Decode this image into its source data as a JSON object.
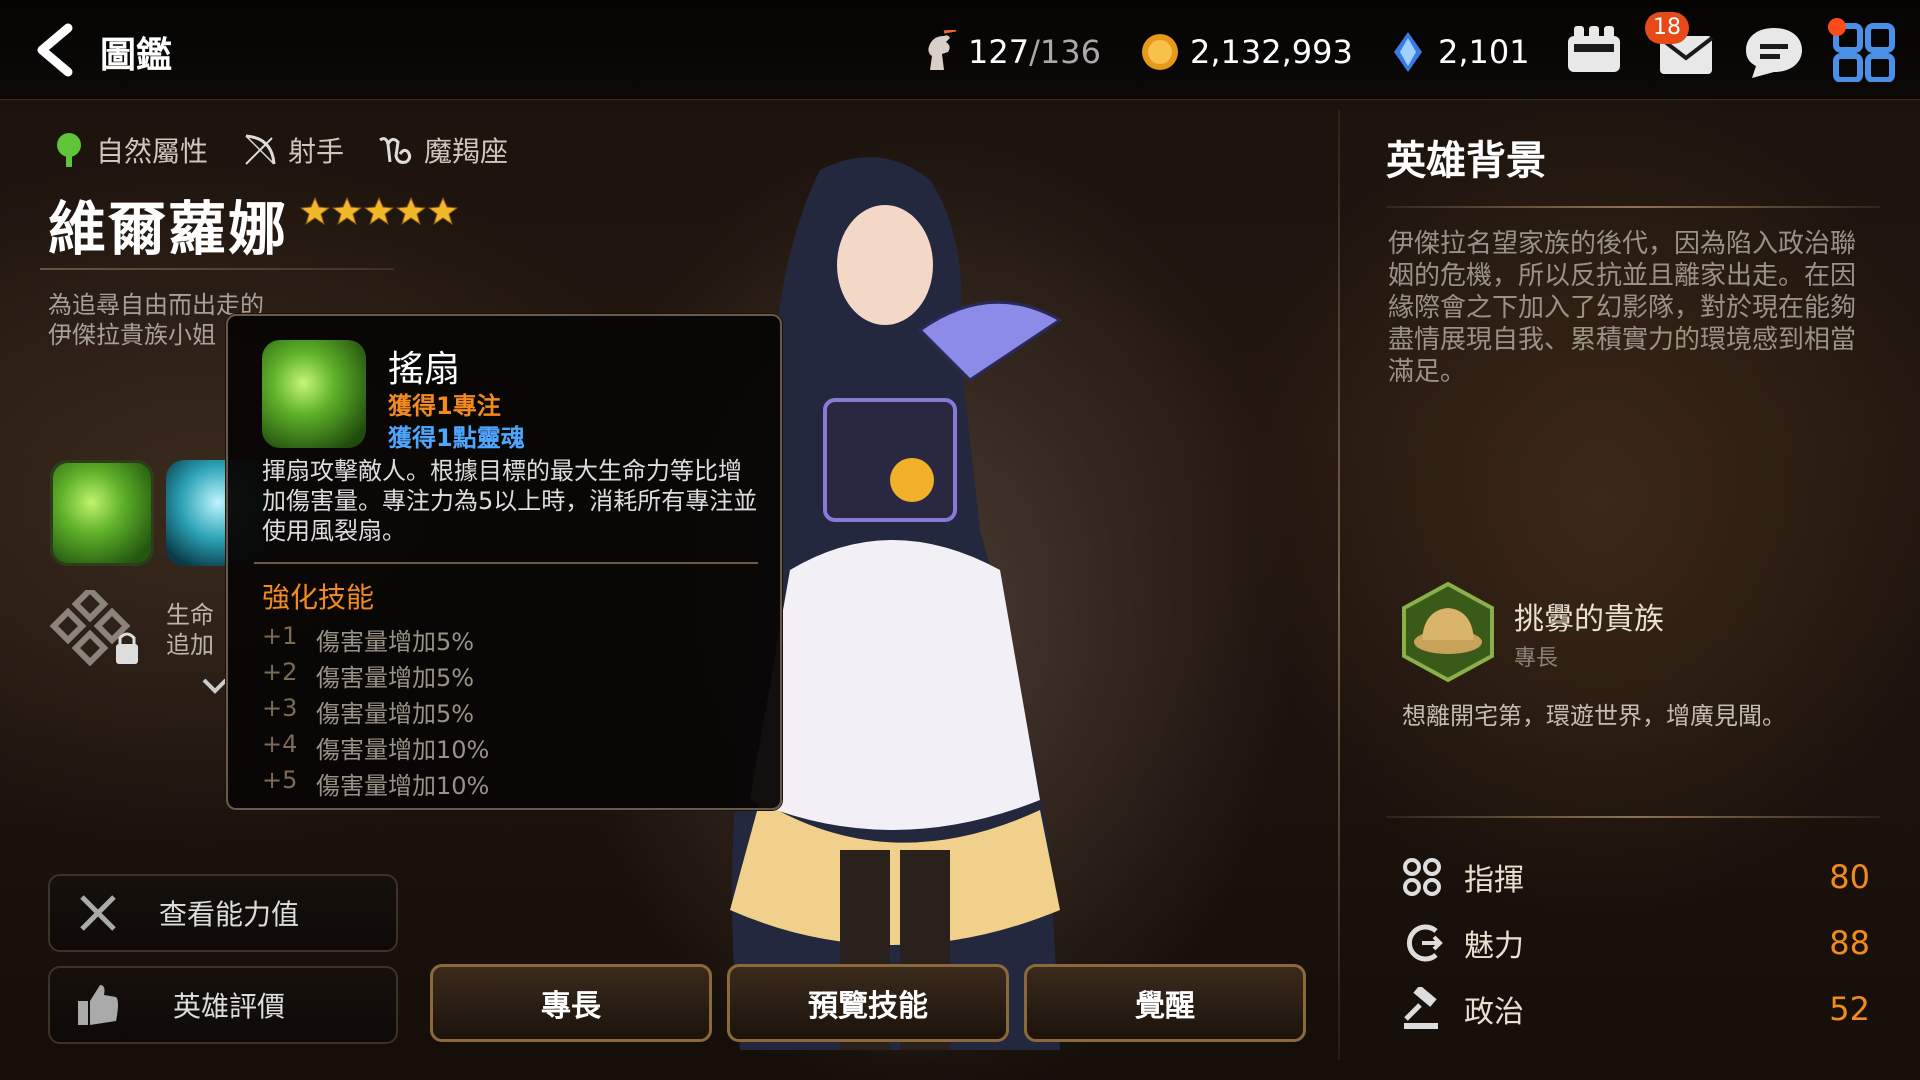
{
  "header": {
    "title": "圖鑑",
    "stamina": {
      "current": "127",
      "max": "/136"
    },
    "gold": "2,132,993",
    "crystals": "2,101",
    "mail_badge": "18"
  },
  "hero": {
    "element": "自然屬性",
    "role": "射手",
    "zodiac": "魔羯座",
    "name": "維爾蘿娜",
    "stars": 5,
    "tagline": "為追尋自由而出走的\n伊傑拉貴族小姐",
    "passive_text": "生命\n追加"
  },
  "tooltip": {
    "title": "搖扇",
    "gain_focus": "獲得1專注",
    "gain_soul": "獲得1點靈魂",
    "description": "揮扇攻擊敵人。根據目標的最大生命力等比增加傷害量。專注力為5以上時，消耗所有專注並使用風裂扇。",
    "enhance_title": "強化技能",
    "enhancements": [
      {
        "level": "+1",
        "effect": "傷害量增加5%"
      },
      {
        "level": "+2",
        "effect": "傷害量增加5%"
      },
      {
        "level": "+3",
        "effect": "傷害量增加5%"
      },
      {
        "level": "+4",
        "effect": "傷害量增加10%"
      },
      {
        "level": "+5",
        "effect": "傷害量增加10%"
      }
    ]
  },
  "buttons": {
    "view_stats": "查看能力值",
    "hero_review": "英雄評價"
  },
  "tabs": [
    "專長",
    "預覽技能",
    "覺醒"
  ],
  "background": {
    "title": "英雄背景",
    "text": "伊傑拉名望家族的後代，因為陷入政治聯姻的危機，所以反抗並且離家出走。在因緣際會之下加入了幻影隊，對於現在能夠盡情展現自我、累積實力的環境感到相當滿足。"
  },
  "specialty": {
    "name": "挑釁的貴族",
    "label": "專長",
    "description": "想離開宅第，環遊世界，增廣見聞。"
  },
  "stats": [
    {
      "icon": "command-icon",
      "label": "指揮",
      "value": "80"
    },
    {
      "icon": "charm-icon",
      "label": "魅力",
      "value": "88"
    },
    {
      "icon": "politics-icon",
      "label": "政治",
      "value": "52"
    }
  ],
  "colors": {
    "accent_orange": "#f28a1e",
    "accent_blue": "#4ea7ff",
    "badge_red": "#e84a17"
  }
}
